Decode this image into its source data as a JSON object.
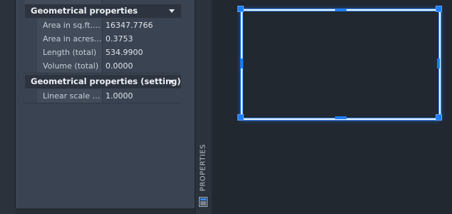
{
  "properties_panel": {
    "tab_label": "PROPERTIES",
    "sections": [
      {
        "title": "Geometrical properties",
        "rows": [
          {
            "label": "Area in sq.ft....",
            "value": "16347.7766"
          },
          {
            "label": "Area in acres...",
            "value": "0.3753"
          },
          {
            "label": "Length (total)",
            "value": "534.9900"
          },
          {
            "label": "Volume (total)",
            "value": "0.0000"
          }
        ]
      },
      {
        "title": "Geometrical properties (setting)",
        "rows": [
          {
            "label": "Linear scale f...",
            "value": "1.0000"
          }
        ]
      }
    ]
  },
  "colors": {
    "selection": "#1e7ef2",
    "panel_bg": "#3a4352",
    "canvas_bg": "#212830"
  },
  "icons": {
    "palette_icon": "properties-palette-icon",
    "section_toggle": "chevron-down-icon"
  }
}
